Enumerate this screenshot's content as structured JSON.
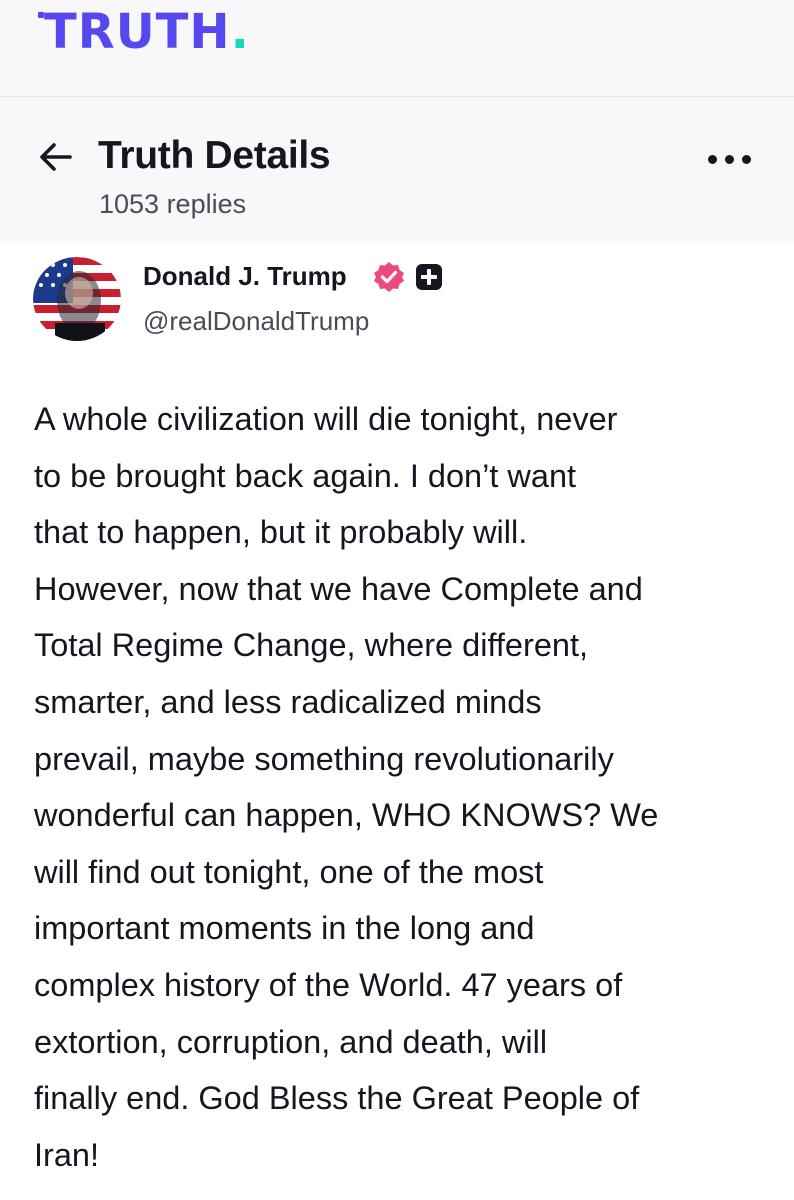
{
  "brand": {
    "name": "TRUTH",
    "dot": ".",
    "primary_color": "#5448ee",
    "accent_color": "#1ad6b9"
  },
  "header": {
    "title": "Truth Details",
    "replies": "1053 replies",
    "back_icon": "arrow-left-icon",
    "more_icon": "more-horizontal-icon"
  },
  "author": {
    "name": "Donald J. Trump",
    "handle": "@realDonaldTrump",
    "verified_icon": "verified-badge-icon",
    "verified_color": "#ec4a7f",
    "plus_icon": "plus-badge-icon"
  },
  "post": {
    "text": "A whole civilization will die tonight, never\nto be brought back again. I don’t want\nthat to happen, but it probably will.\nHowever, now that we have Complete and\nTotal Regime Change, where different,\nsmarter, and less radicalized minds\nprevail, maybe something revolutionarily\nwonderful can happen, WHO KNOWS? We\nwill find out tonight, one of the most\nimportant moments in the long and\ncomplex history of the World. 47 years of\nextortion, corruption, and death, will\nfinally end. God Bless the Great People of\nIran!"
  }
}
